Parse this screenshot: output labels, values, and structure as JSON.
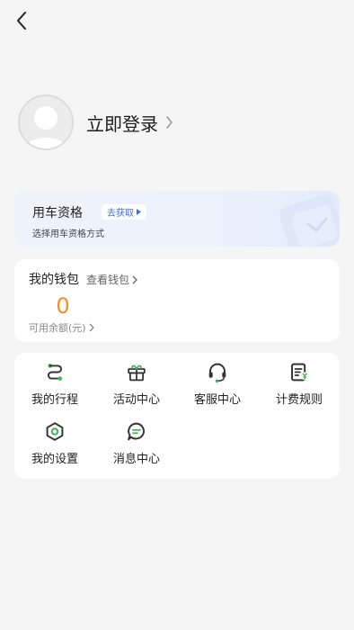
{
  "profile": {
    "login_label": "立即登录"
  },
  "qualification": {
    "title": "用车资格",
    "link_label": "去获取",
    "subtitle": "选择用车资格方式"
  },
  "wallet": {
    "title": "我的钱包",
    "view_label": "查看钱包",
    "balance": "0",
    "balance_label": "可用余额(元)"
  },
  "menu": {
    "items": [
      {
        "label": "我的行程",
        "icon": "route-icon"
      },
      {
        "label": "活动中心",
        "icon": "gift-icon"
      },
      {
        "label": "客服中心",
        "icon": "headset-icon"
      },
      {
        "label": "计费规则",
        "icon": "billing-icon"
      },
      {
        "label": "我的设置",
        "icon": "settings-icon"
      },
      {
        "label": "消息中心",
        "icon": "message-icon"
      }
    ]
  },
  "colors": {
    "accent_green": "#46b35a",
    "balance_orange": "#f0901f",
    "link_blue": "#3d6fd8"
  }
}
